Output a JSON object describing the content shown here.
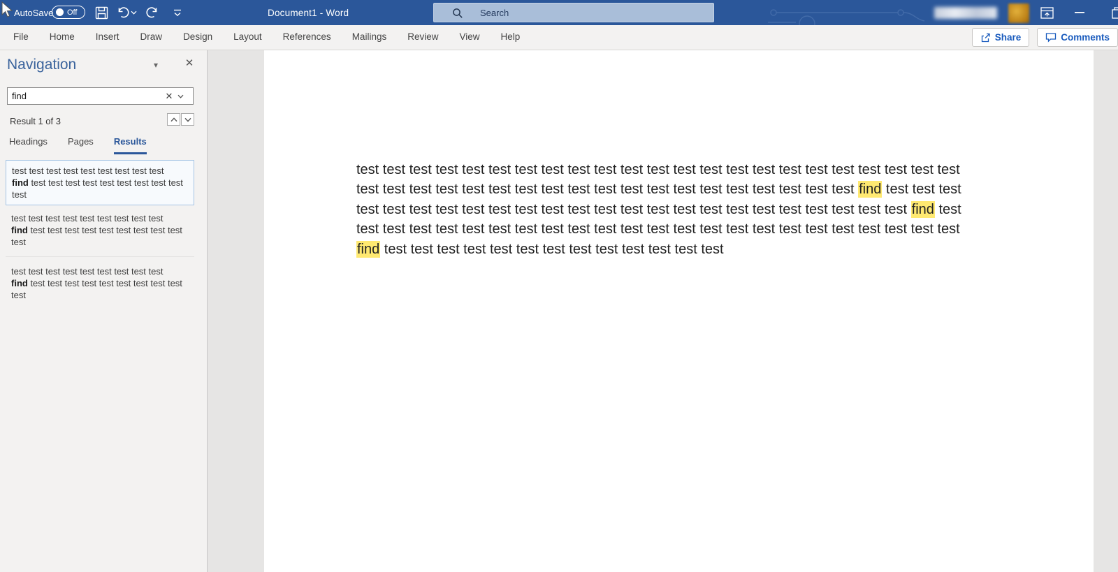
{
  "colors": {
    "titlebar_bg": "#2b579a",
    "accent_blue": "#2b579a",
    "share_text": "#185abd",
    "highlight_yellow": "#ffe971",
    "selected_result_border": "#a5c4e4"
  },
  "titlebar": {
    "autosave_label": "AutoSave",
    "autosave_state": "Off",
    "document_title": "Document1  -  Word",
    "search_placeholder": "Search"
  },
  "ribbon": {
    "tabs": [
      "File",
      "Home",
      "Insert",
      "Draw",
      "Design",
      "Layout",
      "References",
      "Mailings",
      "Review",
      "View",
      "Help"
    ],
    "share_label": "Share",
    "comments_label": "Comments"
  },
  "navigation_pane": {
    "title": "Navigation",
    "search_value": "find",
    "search_clear_icon": "✕",
    "result_counter": "Result 1 of 3",
    "tabs": [
      {
        "label": "Headings",
        "active": false
      },
      {
        "label": "Pages",
        "active": false
      },
      {
        "label": "Results",
        "active": true
      }
    ],
    "results": [
      {
        "selected": true,
        "lines": [
          [
            {
              "text": "test test test test test test test test test"
            }
          ],
          [
            {
              "bold": true,
              "text": "find"
            },
            {
              "text": " test test test test test test test test test"
            }
          ],
          [
            {
              "text": "test"
            }
          ]
        ]
      },
      {
        "selected": false,
        "lines": [
          [
            {
              "text": "test test test test test test test test test"
            }
          ],
          [
            {
              "bold": true,
              "text": "find"
            },
            {
              "text": " test test test test test test test test test"
            }
          ],
          [
            {
              "text": "test"
            }
          ]
        ]
      },
      {
        "selected": false,
        "lines": [
          [
            {
              "text": "test test test test test test test test test"
            }
          ],
          [
            {
              "bold": true,
              "text": "find"
            },
            {
              "text": " test test test test test test test test test"
            }
          ],
          [
            {
              "text": "test"
            }
          ]
        ]
      }
    ]
  },
  "document": {
    "lines": [
      [
        {
          "text": "test test test test test test test test test test test test test test test test test test test test test test test"
        }
      ],
      [
        {
          "text": "test test test test test test test test test test test test test test test test test test test "
        },
        {
          "hl": true,
          "text": "find"
        },
        {
          "text": " test test test"
        }
      ],
      [
        {
          "text": "test test test test test test test test test test test test test test test test test test test test test "
        },
        {
          "hl": true,
          "text": "find"
        },
        {
          "text": " test"
        }
      ],
      [
        {
          "text": "test test test test test test test test test test test test test test test test test test test test test test test"
        }
      ],
      [
        {
          "hl": true,
          "text": "find"
        },
        {
          "text": " test test test test test test test test test test test test test"
        }
      ]
    ]
  }
}
